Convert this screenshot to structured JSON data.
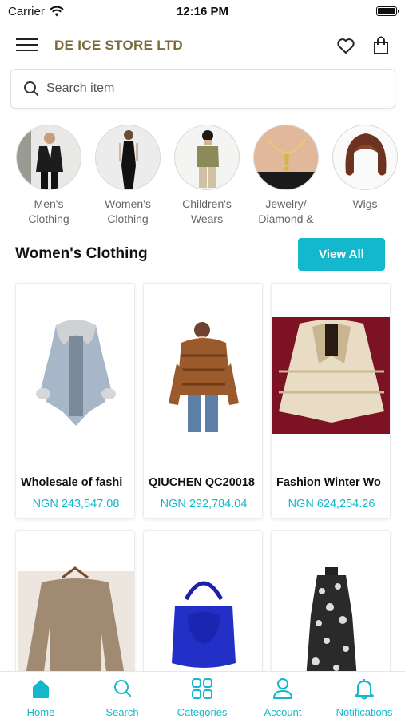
{
  "status_bar": {
    "carrier": "Carrier",
    "time": "12:16 PM"
  },
  "header": {
    "store_name": "DE ICE STORE LTD"
  },
  "search": {
    "placeholder": "Search item"
  },
  "categories": [
    {
      "label": "Men's Clothing"
    },
    {
      "label": "Women's Clothing"
    },
    {
      "label": "Children's Wears"
    },
    {
      "label": "Jewelry/ Diamond &"
    },
    {
      "label": "Wigs"
    }
  ],
  "section": {
    "title": "Women's Clothing",
    "view_all_label": "View All"
  },
  "products": [
    {
      "name": "Wholesale of fashi",
      "price": "NGN 243,547.08"
    },
    {
      "name": "QIUCHEN QC20018",
      "price": "NGN 292,784.04"
    },
    {
      "name": "Fashion Winter Wo",
      "price": "NGN 624,254.26"
    },
    {
      "name": "",
      "price": ""
    },
    {
      "name": "",
      "price": ""
    },
    {
      "name": "",
      "price": ""
    }
  ],
  "tabbar": {
    "items": [
      {
        "label": "Home",
        "icon": "home-icon"
      },
      {
        "label": "Search",
        "icon": "search-icon"
      },
      {
        "label": "Categories",
        "icon": "grid-icon"
      },
      {
        "label": "Account",
        "icon": "user-icon"
      },
      {
        "label": "Notifications",
        "icon": "bell-icon"
      }
    ]
  },
  "colors": {
    "accent": "#14b8cc",
    "brand": "#7a6a3a"
  }
}
